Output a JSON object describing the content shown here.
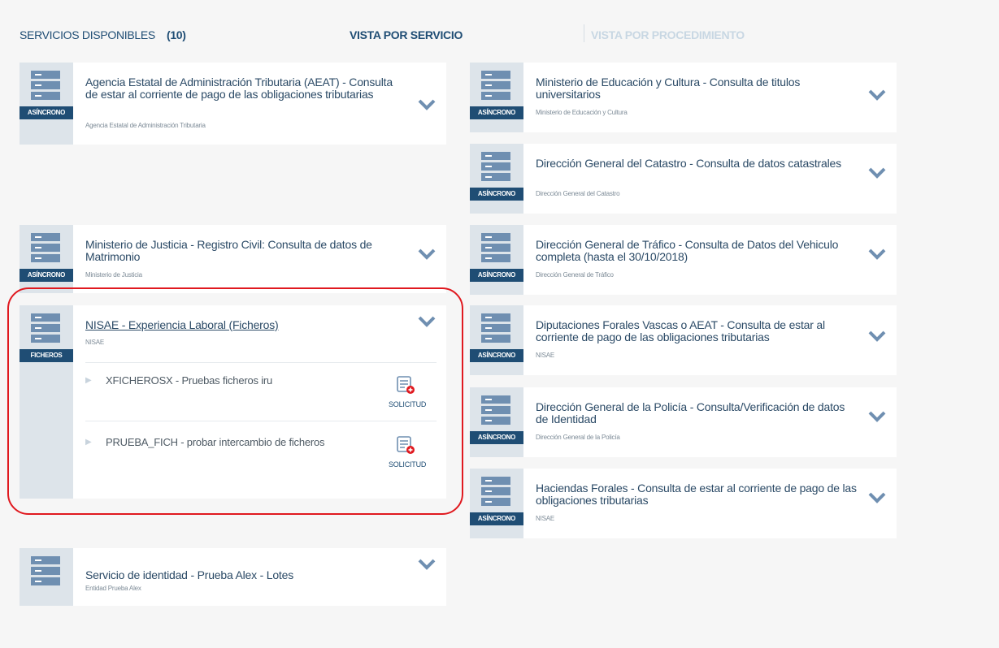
{
  "header": {
    "services_label": "SERVICIOS DISPONIBLES",
    "services_count": "(10)",
    "view_by_service": "VISTA POR SERVICIO",
    "view_by_procedure": "VISTA POR PROCEDIMIENTO"
  },
  "cards": [
    {
      "title": "Agencia Estatal de Administración Tributaria (AEAT) - Consulta de estar al corriente de pago de las obligaciones tributarias",
      "entity": "Agencia Estatal de Administración Tributaria",
      "badge": "ASÍNCRONO"
    },
    {
      "title": "Ministerio de Justicia - Registro Civil: Consulta de datos de Matrimonio",
      "entity": "Ministerio de Justicia",
      "badge": "ASÍNCRONO"
    },
    {
      "title": "NISAE - Experiencia Laboral (Ficheros)",
      "entity": "NISAE",
      "badge": "FICHEROS",
      "procedures": [
        {
          "text": "XFICHEROSX - Pruebas ficheros iru",
          "button": "SOLICITUD"
        },
        {
          "text": "PRUEBA_FICH - probar intercambio de ficheros",
          "button": "SOLICITUD"
        }
      ]
    },
    {
      "title": "Servicio de identidad - Prueba Alex - Lotes",
      "entity": "Entidad Prueba Alex",
      "badge": ""
    },
    {
      "title": "Ministerio de Educación y Cultura - Consulta de titulos universitarios",
      "entity": "Ministerio de Educación y Cultura",
      "badge": "ASÍNCRONO"
    },
    {
      "title": "Dirección General del Catastro - Consulta de datos catastrales",
      "entity": "Dirección General del Catastro",
      "badge": "ASÍNCRONO"
    },
    {
      "title": "Dirección General de Tráfico - Consulta de Datos del Vehiculo completa (hasta el 30/10/2018)",
      "entity": "Dirección General de Tráfico",
      "badge": "ASÍNCRONO"
    },
    {
      "title": "Diputaciones Forales Vascas o AEAT - Consulta de estar al corriente de pago de las obligaciones tributarias",
      "entity": "NISAE",
      "badge": "ASÍNCRONO"
    },
    {
      "title": "Dirección General de la Policía - Consulta/Verificación de datos de Identidad",
      "entity": "Dirección General de la Policía",
      "badge": "ASÍNCRONO"
    },
    {
      "title": "Haciendas Forales - Consulta de estar al corriente de pago de las obligaciones tributarias",
      "entity": "NISAE",
      "badge": "ASÍNCRONO"
    }
  ],
  "icons": {
    "service": "server-stack-icon",
    "expand": "chevron-down-icon",
    "procedure": "triangle-right-icon",
    "request": "list-add-icon"
  },
  "colors": {
    "primary": "#1f4d74",
    "icon_blue": "#6f8fb1",
    "sidebar": "#dde4ea",
    "highlight": "#e0191f",
    "add_red": "#e0191f"
  }
}
